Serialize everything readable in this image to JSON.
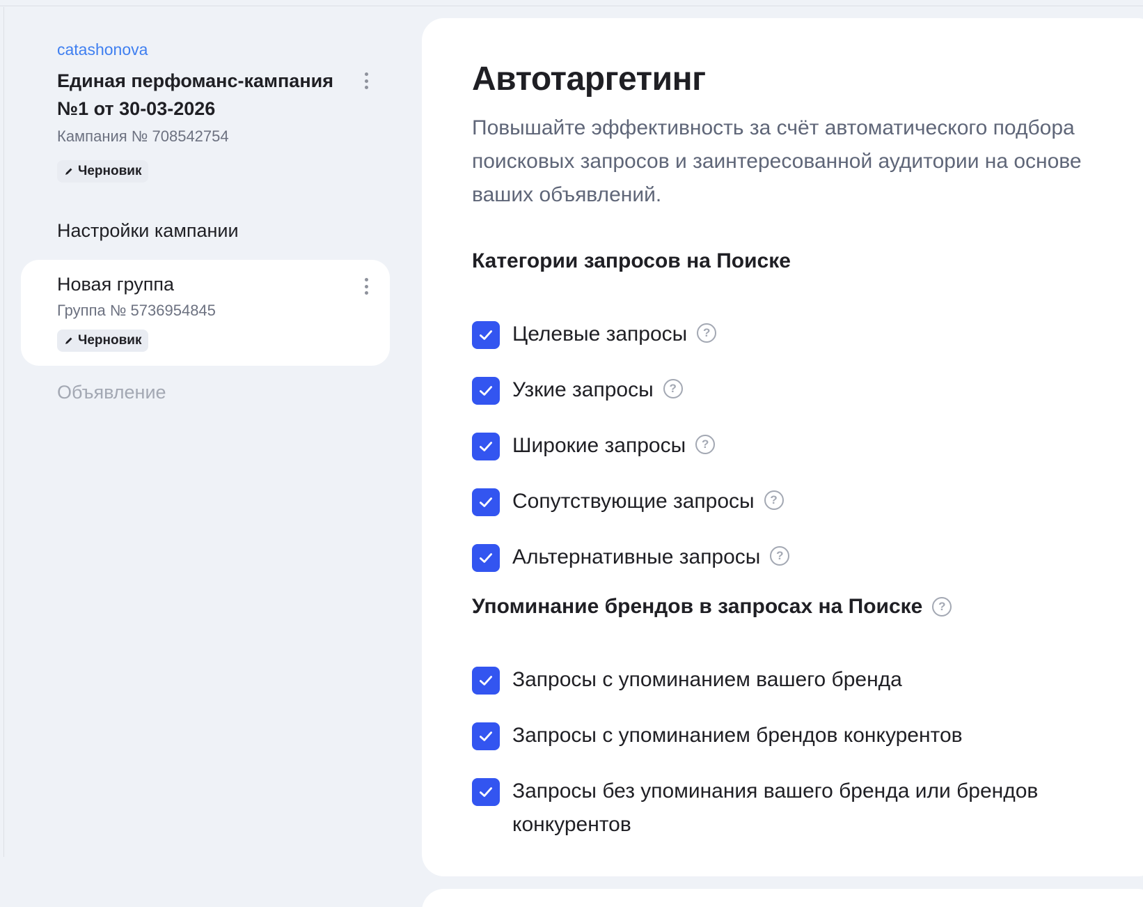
{
  "sidebar": {
    "login": "catashonova",
    "campaign": {
      "title": "Единая перфоманс-кампания №1 от 30-03-2026",
      "id_label": "Кампания № 708542754",
      "status": "Черновик"
    },
    "settings_label": "Настройки кампании",
    "group": {
      "title": "Новая группа",
      "id_label": "Группа № 5736954845",
      "status": "Черновик"
    },
    "ad_label": "Объявление"
  },
  "main": {
    "title": "Автотаргетинг",
    "description": "Повышайте эффективность за счёт автоматического подбора поисковых запросов и заинтересованной аудитории на основе ваших объявлений.",
    "search_categories": {
      "heading": "Категории запросов на Поиске",
      "items": [
        {
          "label": "Целевые запросы",
          "checked": true
        },
        {
          "label": "Узкие запросы",
          "checked": true
        },
        {
          "label": "Широкие запросы",
          "checked": true
        },
        {
          "label": "Сопутствующие запросы",
          "checked": true
        },
        {
          "label": "Альтернативные запросы",
          "checked": true
        }
      ]
    },
    "brand_mentions": {
      "heading": "Упоминание брендов в запросах на Поиске",
      "items": [
        {
          "label": "Запросы с упоминанием вашего бренда",
          "checked": true
        },
        {
          "label": "Запросы с упоминанием брендов конкурентов",
          "checked": true
        },
        {
          "label": "Запросы без упоминания вашего бренда или брендов конкурентов",
          "checked": true
        }
      ]
    }
  },
  "icons": {
    "help": "question-circle-icon",
    "check": "checkmark-icon",
    "pencil": "pencil-icon",
    "more": "more-vertical-icon"
  },
  "colors": {
    "accent": "#3355f0",
    "link": "#3f7ff0",
    "background": "#eff2f7"
  }
}
